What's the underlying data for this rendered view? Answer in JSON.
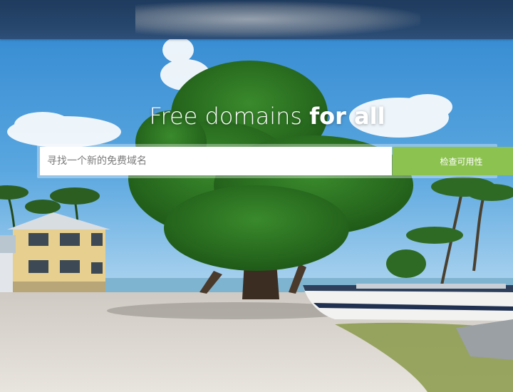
{
  "hero": {
    "headline_light": "Free domains ",
    "headline_bold": "for all"
  },
  "search": {
    "placeholder": "寻找一个新的免费域名",
    "value": "",
    "button_label": "检查可用性"
  },
  "colors": {
    "accent_button": "#8cc24f",
    "top_bar": "#27476d"
  }
}
